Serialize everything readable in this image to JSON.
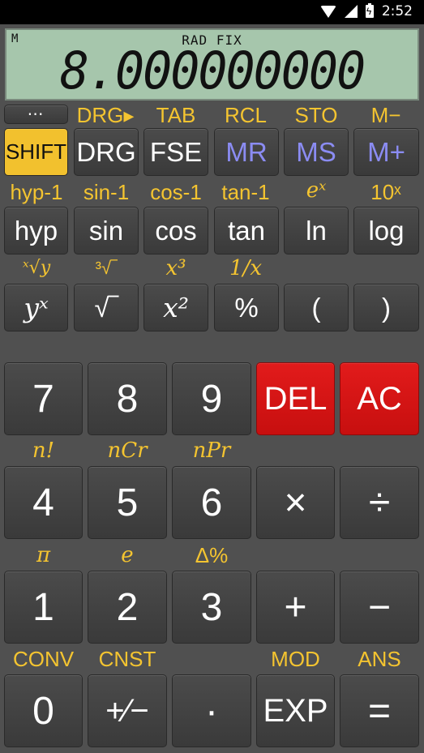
{
  "status": {
    "time": "2:52"
  },
  "display": {
    "memory_indicator": "M",
    "mode": "RAD FIX",
    "value": "8.000000000"
  },
  "shift_labels": {
    "drg_arrow": "DRG▸",
    "tab": "TAB",
    "rcl": "RCL",
    "sto": "STO",
    "m_minus": "M−",
    "hyp_inv": "hyp-1",
    "sin_inv": "sin-1",
    "cos_inv": "cos-1",
    "tan_inv": "tan-1",
    "exp": "eˣ",
    "ten_pow": "10ˣ",
    "xroot": "ˣ√y",
    "cbrt": "³√‾",
    "cube": "x³",
    "recip": "1/x",
    "fact": "n!",
    "ncr": "nCr",
    "npr": "nPr",
    "pi": "π",
    "e": "e",
    "delta_pct": "Δ%",
    "conv": "CONV",
    "cnst": "CNST",
    "mod": "MOD",
    "ans": "ANS"
  },
  "buttons": {
    "menu": "⋯",
    "shift": "SHIFT",
    "drg": "DRG",
    "fse": "FSE",
    "mr": "MR",
    "ms": "MS",
    "mplus": "M+",
    "hyp": "hyp",
    "sin": "sin",
    "cos": "cos",
    "tan": "tan",
    "ln": "ln",
    "log": "log",
    "ypow": "yˣ",
    "sqrt": "√‾",
    "square": "x²",
    "percent": "%",
    "lparen": "(",
    "rparen": ")",
    "d7": "7",
    "d8": "8",
    "d9": "9",
    "del": "DEL",
    "ac": "AC",
    "d4": "4",
    "d5": "5",
    "d6": "6",
    "mul": "×",
    "div": "÷",
    "d1": "1",
    "d2": "2",
    "d3": "3",
    "add": "+",
    "sub": "−",
    "d0": "0",
    "neg": "+∕−",
    "dot": "·",
    "exp": "EXP",
    "eq": "="
  }
}
